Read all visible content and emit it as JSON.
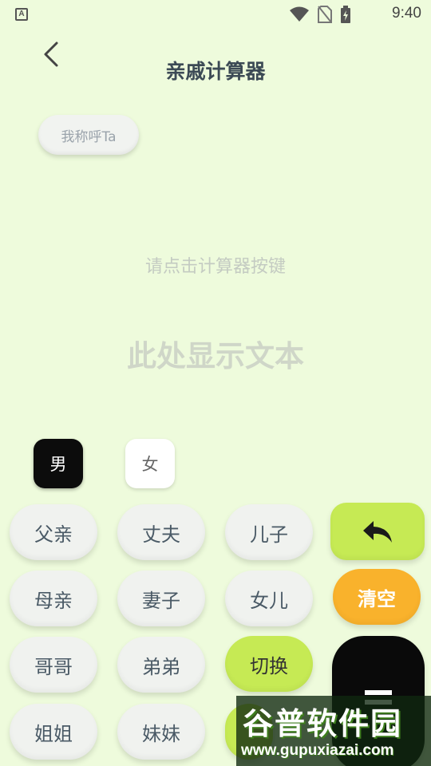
{
  "status_bar": {
    "left_badge": "A",
    "time": "9:40"
  },
  "header": {
    "title": "亲戚计算器"
  },
  "call_me": {
    "label": "我称呼Ta"
  },
  "display": {
    "prompt": "请点击计算器按键",
    "result": "此处显示文本"
  },
  "gender": {
    "male": "男",
    "female": "女"
  },
  "keys": {
    "father": "父亲",
    "husband": "丈夫",
    "son": "儿子",
    "mother": "母亲",
    "wife": "妻子",
    "daughter": "女儿",
    "clear": "清空",
    "elder_brother": "哥哥",
    "younger_brother": "弟弟",
    "switch": "切换",
    "elder_sister": "姐姐",
    "younger_sister": "妹妹"
  },
  "colors": {
    "background": "#eefbdc",
    "accent_green": "#c6ea54",
    "accent_orange": "#f9b22c",
    "black": "#0a0a0a"
  },
  "icons": {
    "back": "chevron-left-icon",
    "backspace": "reply-arrow-icon",
    "equals": "equals-icon"
  },
  "watermark": {
    "logo": "谷普软件园",
    "url": "www.gupuxiazai.com"
  }
}
